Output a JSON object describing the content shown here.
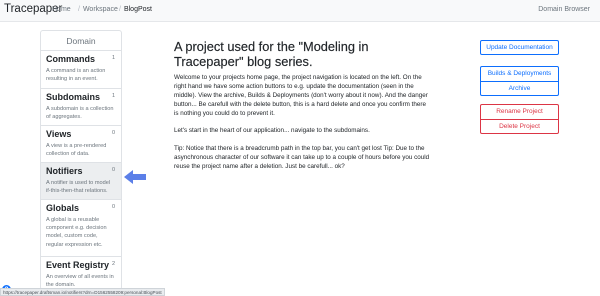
{
  "navbar": {
    "brand": "Tracepaper",
    "breadcrumb": [
      {
        "label": "Home"
      },
      {
        "label": "Workspace"
      },
      {
        "label": "BlogPost"
      }
    ],
    "separator": "/",
    "domain_browser": "Domain Browser"
  },
  "sidebar": {
    "header": "Domain",
    "items": [
      {
        "title": "Commands",
        "count": "1",
        "desc": "A command is an action resulting in an event."
      },
      {
        "title": "Subdomains",
        "count": "1",
        "desc": "A subdomain is a collection of aggregates."
      },
      {
        "title": "Views",
        "count": "0",
        "desc": "A view is a pre-rendered collection of data."
      },
      {
        "title": "Notifiers",
        "count": "0",
        "desc": "A notifier is used to model if-this-then-that relations."
      },
      {
        "title": "Globals",
        "count": "0",
        "desc": "A global is a reusable component e.g. decision model, custom code, regular expression etc."
      },
      {
        "title": "Event Registry",
        "count": "2",
        "desc": "An overview of all events in the domain."
      }
    ]
  },
  "main": {
    "title": "A project used for the \"Modeling in Tracepaper\" blog series.",
    "paragraphs": [
      "Welcome to your projects home page, the project navigation is located on the left. On the right hand we have some action buttons to e.g. update the documentation (seen in the middle). View the archive, Builds & Deployments (don't worry about it now). And the danger button... Be carefull with the delete button, this is a hard delete and once you confirm there is nothing you could do to prevent it.",
      "Let's start in the heart of our application... navigate to the subdomains.",
      "Tip: Notice that there is a breadcrumb path in the top bar, you can't get lost Tip: Due to the asynchronous character of our software it can take up to a couple of hours before you could reuse the project name after a deletion. Just be carefull... ok?"
    ]
  },
  "actions": {
    "update_docs": "Update Documentation",
    "builds": "Builds & Deployments",
    "archive": "Archive",
    "rename": "Rename Project",
    "delete": "Delete Project"
  },
  "statusbar": {
    "url": "https://tracepaper.draftsman.io/notifiers?drn=D1562558209:personal:BlogPost"
  },
  "help": {
    "label": "?"
  },
  "colors": {
    "primary": "#0d6efd",
    "danger": "#dc3545",
    "arrow": "#5b7fe8",
    "active_item": "#eceef0"
  }
}
